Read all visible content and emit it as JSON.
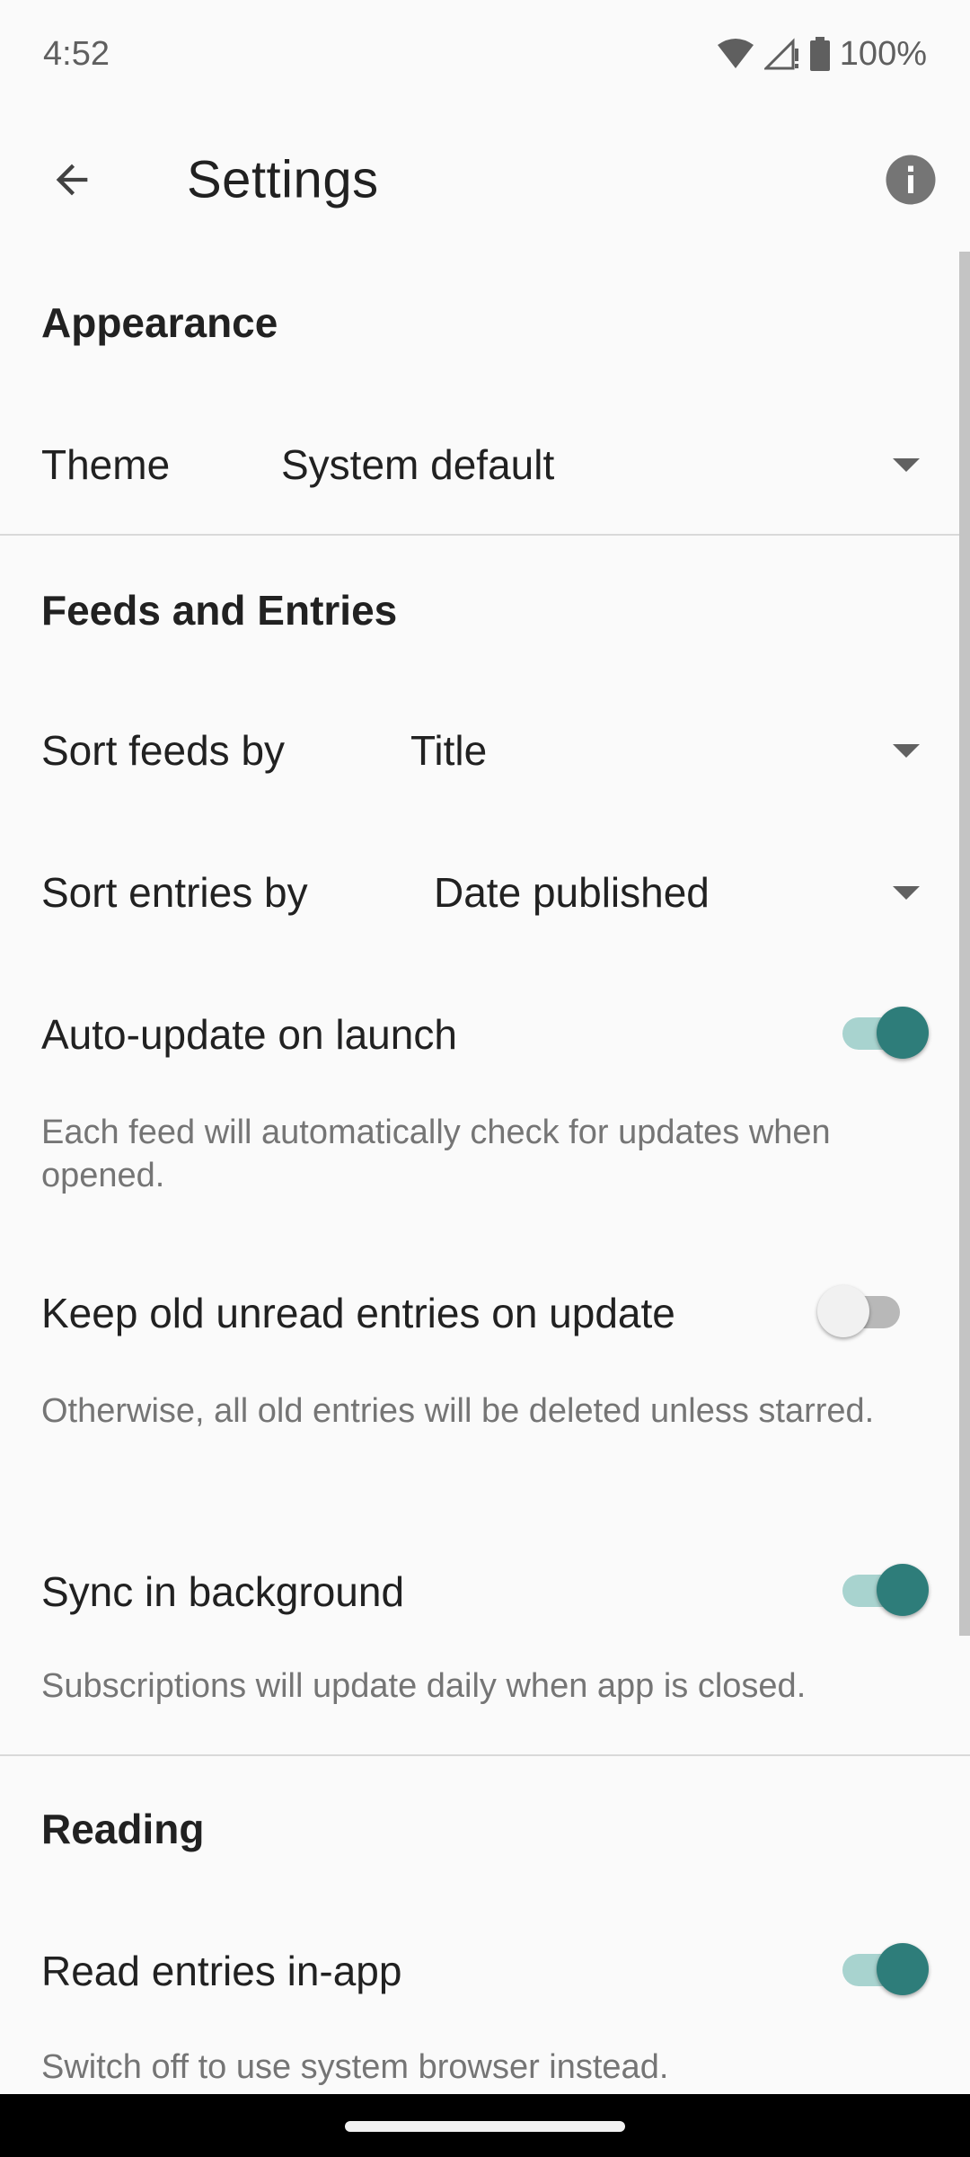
{
  "status_bar": {
    "time": "4:52",
    "battery": "100%",
    "icons": [
      "wifi-icon",
      "signal-icon",
      "battery-icon"
    ]
  },
  "app_bar": {
    "title": "Settings",
    "back_icon": "arrow-back-icon",
    "info_icon": "info-icon"
  },
  "sections": {
    "appearance": {
      "header": "Appearance",
      "theme_label": "Theme",
      "theme_value": "System default"
    },
    "feeds": {
      "header": "Feeds and Entries",
      "sort_feeds_label": "Sort feeds by",
      "sort_feeds_value": "Title",
      "sort_entries_label": "Sort entries by",
      "sort_entries_value": "Date published",
      "auto_update_label": "Auto-update on launch",
      "auto_update_on": true,
      "auto_update_desc": "Each feed will automatically check for updates when opened.",
      "keep_old_label": "Keep old unread entries on update",
      "keep_old_on": false,
      "keep_old_desc": "Otherwise, all old entries will be deleted unless starred.",
      "sync_label": "Sync in background",
      "sync_on": true,
      "sync_desc": "Subscriptions will update daily when app is closed."
    },
    "reading": {
      "header": "Reading",
      "read_inapp_label": "Read entries in-app",
      "read_inapp_on": true,
      "read_inapp_desc": "Switch off to use system browser instead."
    }
  },
  "colors": {
    "accent": "#2e7d7a",
    "accent_track": "#a8d3cf",
    "background": "#fafafa"
  }
}
